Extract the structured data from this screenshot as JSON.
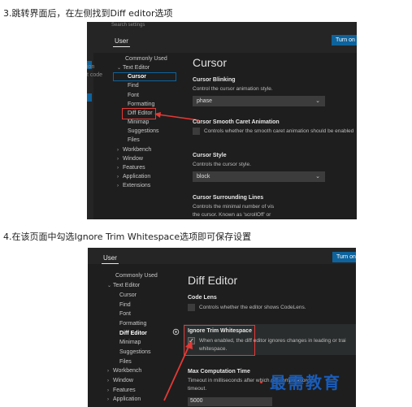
{
  "captions": {
    "step3": "3.跳转界面后，在左侧找到Diff editor选项",
    "step4": "4.在该页面中勾选Ignore Trim Whitespace选项即可保存设置"
  },
  "shot1": {
    "search_placeholder": "Search settings",
    "user_tab": "User",
    "turn_on_button": "Turn on S",
    "left_partial": [
      "ion",
      "t code"
    ],
    "tree": [
      "Commonly Used",
      "Text Editor",
      "Cursor",
      "Find",
      "Font",
      "Formatting",
      "Diff Editor",
      "Minimap",
      "Suggestions",
      "Files",
      "Workbench",
      "Window",
      "Features",
      "Application",
      "Extensions"
    ],
    "section_title": "Cursor",
    "settings": {
      "blinking_title": "Cursor Blinking",
      "blinking_desc": "Control the cursor animation style.",
      "blinking_value": "phase",
      "smooth_title": "Cursor Smooth Caret Animation",
      "smooth_desc": "Controls whether the smooth caret animation should be enabled",
      "style_title": "Cursor Style",
      "style_desc": "Controls the cursor style.",
      "style_value": "block",
      "surrounding_title": "Cursor Surrounding Lines",
      "surrounding_desc1": "Controls the minimal number of vis",
      "surrounding_desc2": "the cursor. Known as 'scrollOff' or"
    }
  },
  "shot2": {
    "user_tab": "User",
    "turn_on_button": "Turn on",
    "tree": [
      "Commonly Used",
      "Text Editor",
      "Cursor",
      "Find",
      "Font",
      "Formatting",
      "Diff Editor",
      "Minimap",
      "Suggestions",
      "Files",
      "Workbench",
      "Window",
      "Features",
      "Application"
    ],
    "section_title": "Diff Editor",
    "settings": {
      "codelens_title": "Code Lens",
      "codelens_desc": "Controls whether the editor shows CodeLens.",
      "ignore_title": "Ignore Trim Whitespace",
      "ignore_desc1": "When enabled, the diff editor ignores changes in leading or trai",
      "ignore_desc2": "whitespace.",
      "maxtime_title": "Max Computation Time",
      "maxtime_desc1": "Timeout in milliseconds after which diff computation",
      "maxtime_desc2": "timeout.",
      "maxtime_value": "5000"
    }
  },
  "watermark": "最需教育",
  "colors": {
    "accent_blue": "#0e639c",
    "highlight_red": "#e53935",
    "bg_dark": "#1e1e1e"
  }
}
